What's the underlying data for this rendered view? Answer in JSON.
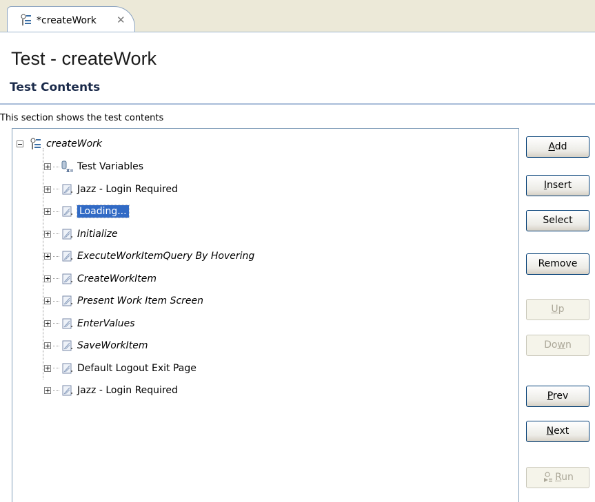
{
  "tab": {
    "label": "*createWork",
    "close_symbol": "✕"
  },
  "editor": {
    "title": "Test - createWork"
  },
  "section": {
    "title": "Test Contents",
    "description": "This section shows the test contents"
  },
  "tree": {
    "root": {
      "label": "createWork",
      "icon": "test-suite-icon"
    },
    "children": [
      {
        "label": "Test Variables",
        "icon": "test-variables-icon",
        "italic": false,
        "selected": false
      },
      {
        "label": "Jazz - Login Required",
        "icon": "page-icon",
        "italic": false,
        "selected": false
      },
      {
        "label": "Loading...",
        "icon": "page-icon",
        "italic": false,
        "selected": true
      },
      {
        "label": "Initialize",
        "icon": "page-icon",
        "italic": true,
        "selected": false
      },
      {
        "label": "ExecuteWorkItemQuery By Hovering",
        "icon": "page-icon",
        "italic": true,
        "selected": false
      },
      {
        "label": "CreateWorkItem",
        "icon": "page-icon",
        "italic": true,
        "selected": false
      },
      {
        "label": "Present Work Item Screen",
        "icon": "page-icon",
        "italic": true,
        "selected": false
      },
      {
        "label": "EnterValues",
        "icon": "page-icon",
        "italic": true,
        "selected": false
      },
      {
        "label": "SaveWorkItem",
        "icon": "page-icon",
        "italic": true,
        "selected": false
      },
      {
        "label": "Default Logout Exit Page",
        "icon": "page-icon",
        "italic": false,
        "selected": false
      },
      {
        "label": "Jazz - Login Required",
        "icon": "page-icon",
        "italic": false,
        "selected": false
      }
    ]
  },
  "buttons": {
    "add": {
      "pre": "",
      "mnemonic": "A",
      "post": "dd",
      "enabled": true
    },
    "insert": {
      "pre": "",
      "mnemonic": "I",
      "post": "nsert",
      "enabled": true
    },
    "select": {
      "label": "Select",
      "enabled": true
    },
    "remove": {
      "label": "Remove",
      "enabled": true
    },
    "up": {
      "pre": "",
      "mnemonic": "U",
      "post": "p",
      "enabled": false
    },
    "down": {
      "pre": "Do",
      "mnemonic": "w",
      "post": "n",
      "enabled": false
    },
    "prev": {
      "pre": "",
      "mnemonic": "P",
      "post": "rev",
      "enabled": true
    },
    "next": {
      "pre": "",
      "mnemonic": "N",
      "post": "ext",
      "enabled": true
    },
    "run": {
      "pre": "",
      "mnemonic": "R",
      "post": "un",
      "enabled": false,
      "icon": "run-icon"
    }
  },
  "colors": {
    "selection": "#316ac5",
    "section_rule": "#a8bcd8",
    "button_border": "#003c74",
    "disabled_text": "#aca899"
  }
}
